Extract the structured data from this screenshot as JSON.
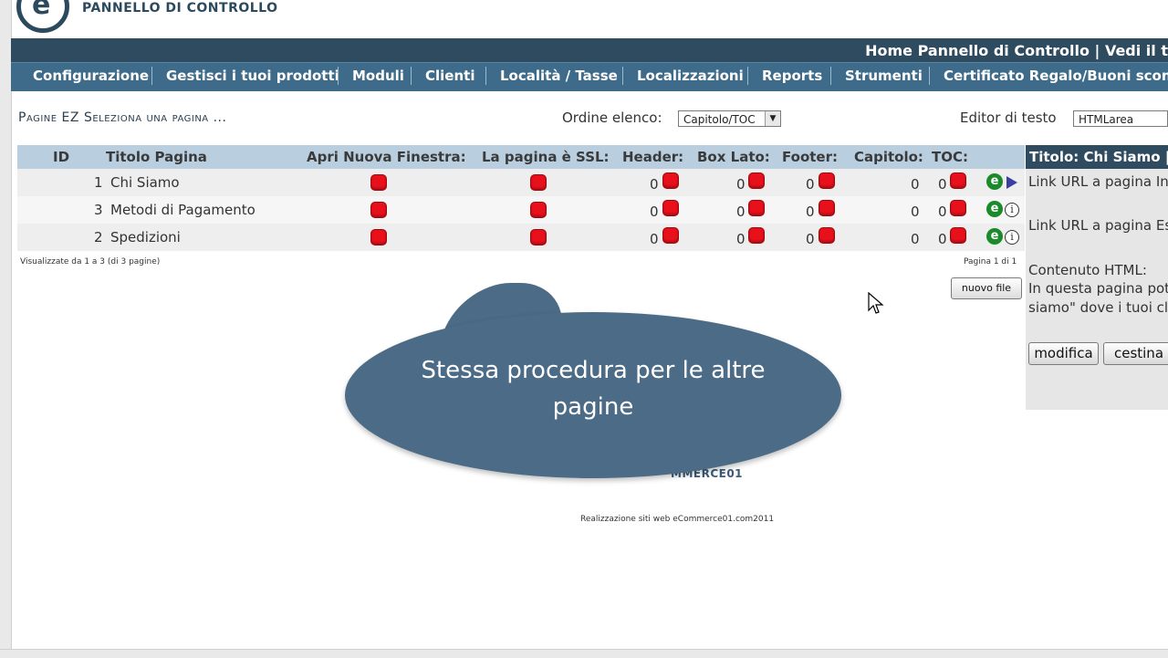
{
  "header": {
    "logo_text": "PANNELLO DI CONTROLLO",
    "top_links": "Home Pannello di Controllo | Vedi il t"
  },
  "nav": {
    "items": [
      "Configurazione",
      "Gestisci i tuoi prodotti",
      "Moduli",
      "Clienti",
      "Località / Tasse",
      "Localizzazioni",
      "Reports",
      "Strumenti",
      "Certificato Regalo/Buoni sconto"
    ]
  },
  "page": {
    "heading": "Pagine EZ Seleziona una pagina ...",
    "order_label": "Ordine elenco:",
    "order_value": "Capitolo/TOC",
    "editor_label": "Editor di testo",
    "editor_value": "HTMLarea"
  },
  "table": {
    "headers": [
      "ID",
      "Titolo Pagina",
      "Apri Nuova Finestra:",
      "La pagina è SSL:",
      "Header:",
      "Box Lato:",
      "Footer:",
      "Capitolo:",
      "TOC:"
    ],
    "rows": [
      {
        "id": "1",
        "title": "Chi Siamo",
        "header": "0",
        "box": "0",
        "footer": "0",
        "chapter": "0",
        "toc": "0"
      },
      {
        "id": "3",
        "title": "Metodi di Pagamento",
        "header": "0",
        "box": "0",
        "footer": "0",
        "chapter": "0",
        "toc": "0"
      },
      {
        "id": "2",
        "title": "Spedizioni",
        "header": "0",
        "box": "0",
        "footer": "0",
        "chapter": "0",
        "toc": "0"
      }
    ],
    "showing": "Visualizzate da 1 a 3 (di 3 pagine)",
    "pagination": "Pagina 1 di 1",
    "new_file": "nuovo file"
  },
  "panel": {
    "title": "Titolo: Chi Siamo |",
    "link_int": "Link URL a pagina In",
    "link_ext": "Link URL a pagina Es",
    "content_label": "Contenuto HTML:",
    "content_line1": "In questa pagina pot",
    "content_line2": "siamo\" dove i tuoi cl",
    "edit_btn": "modifica",
    "trash_btn": "cestina"
  },
  "bubble": {
    "line1": "Stessa procedura per le altre",
    "line2": "pagine"
  },
  "footer": {
    "logo": "MMERCE01",
    "credit": "Realizzazione siti web eCommerce01.com2011"
  },
  "colors": {
    "nav_bg": "#3e6b8a",
    "top_bg": "#2f4b60",
    "table_head": "#b9cfe0",
    "bubble": "#4b6b86",
    "status_red": "#e8101a"
  }
}
